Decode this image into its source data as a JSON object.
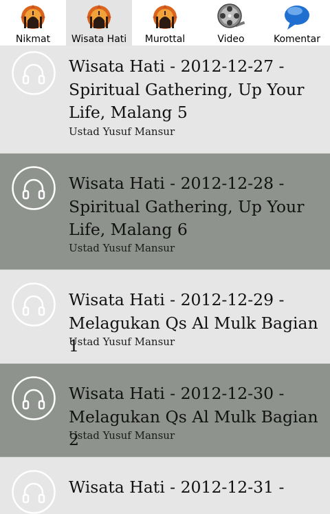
{
  "tabs": [
    {
      "label": "Nikmat",
      "icon": "mosque-icon",
      "active": false
    },
    {
      "label": "Wisata Hati",
      "icon": "mosque-icon",
      "active": true
    },
    {
      "label": "Murottal",
      "icon": "mosque-icon",
      "active": false
    },
    {
      "label": "Video",
      "icon": "film-reel-icon",
      "active": false
    },
    {
      "label": "Komentar",
      "icon": "speech-bubble-icon",
      "active": false
    }
  ],
  "items": [
    {
      "title": "Wisata Hati - 2012-12-27 - Spiritual Gathering, Up Your Life, Malang 5",
      "author": "Ustad Yusuf Mansur",
      "icon": "headphones-icon"
    },
    {
      "title": "Wisata Hati - 2012-12-28 - Spiritual Gathering, Up Your Life, Malang 6",
      "author": "Ustad Yusuf Mansur",
      "icon": "headphones-icon"
    },
    {
      "title": "Wisata Hati - 2012-12-29 - Melagukan Qs Al Mulk Bagian 1",
      "author": "Ustad Yusuf Mansur",
      "icon": "headphones-icon"
    },
    {
      "title": "Wisata Hati - 2012-12-30 - Melagukan Qs Al Mulk Bagian 2",
      "author": "Ustad Yusuf Mansur",
      "icon": "headphones-icon"
    },
    {
      "title": "Wisata Hati - 2012-12-31 -",
      "author": "",
      "icon": "headphones-icon"
    }
  ],
  "colors": {
    "row_light": "#e6e6e6",
    "row_dark": "#8f938e",
    "tab_active": "#e4e4e4"
  }
}
